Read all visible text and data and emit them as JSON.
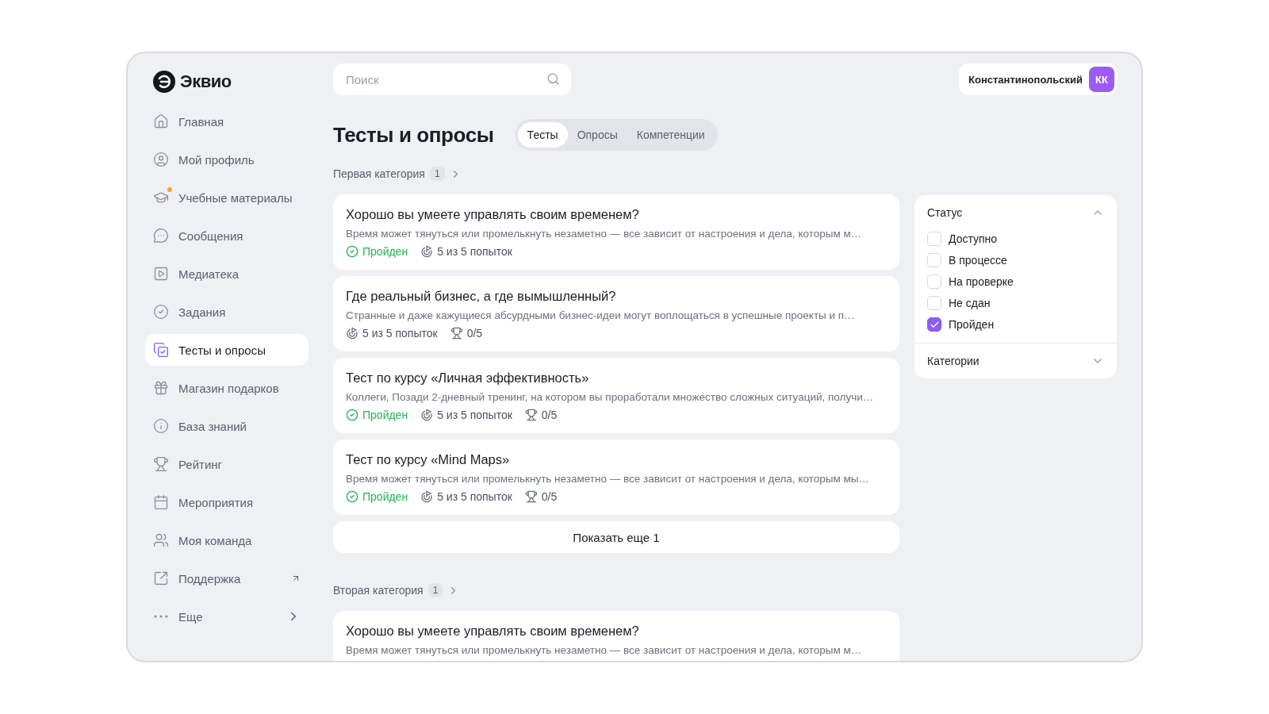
{
  "logo": {
    "name": "Эквио"
  },
  "sidebar": {
    "items": [
      {
        "label": "Главная",
        "kind": "link",
        "selected": false,
        "notification": false
      },
      {
        "label": "Мой профиль",
        "kind": "link",
        "selected": false,
        "notification": false
      },
      {
        "label": "Учебные материалы",
        "kind": "link",
        "selected": false,
        "notification": true
      },
      {
        "label": "Сообщения",
        "kind": "link",
        "selected": false,
        "notification": false
      },
      {
        "label": "Медиатека",
        "kind": "link",
        "selected": false,
        "notification": false
      },
      {
        "label": "Задания",
        "kind": "link",
        "selected": false,
        "notification": false
      },
      {
        "label": "Тесты и опросы",
        "kind": "link",
        "selected": true,
        "notification": false
      },
      {
        "label": "Магазин подарков",
        "kind": "link",
        "selected": false,
        "notification": false
      },
      {
        "label": "База знаний",
        "kind": "link",
        "selected": false,
        "notification": false
      },
      {
        "label": "Рейтинг",
        "kind": "link",
        "selected": false,
        "notification": false
      },
      {
        "label": "Мероприятия",
        "kind": "link",
        "selected": false,
        "notification": false
      },
      {
        "label": "Моя команда",
        "kind": "link",
        "selected": false,
        "notification": false
      },
      {
        "label": "Поддержка",
        "kind": "external",
        "selected": false,
        "notification": false
      },
      {
        "label": "Еще",
        "kind": "more",
        "selected": false,
        "notification": false
      }
    ]
  },
  "header": {
    "search": {
      "placeholder": "Поиск"
    },
    "user": {
      "name": "Константинопольский",
      "initials": "КК"
    }
  },
  "page_title": "Тесты и опросы",
  "tabs": [
    {
      "label": "Тесты",
      "selected": true
    },
    {
      "label": "Опросы",
      "selected": false
    },
    {
      "label": "Компетенции",
      "selected": false
    }
  ],
  "sections": [
    {
      "title": "Первая категория",
      "count": "1",
      "tests": [
        {
          "title": "Хорошо вы умеете управлять своим временем?",
          "description": "Время может тянуться или промелькнуть незаметно — все зависит от настроения и дела, которым м…",
          "status": "Пройден",
          "attempts": "5 из 5 попыток"
        },
        {
          "title": "Где реальный бизнес, а где вымышленный?",
          "description": "Странные и даже кажущиеся абсурдными бизнес-идеи могут воплощаться в успешные проекты и п…",
          "attempts": "5 из 5 попыток",
          "score": "0/5"
        },
        {
          "title": "Тест по курсу «Личная эффективность»",
          "description": "Коллеги, Позади 2-дневный тренинг, на котором вы проработали множество сложных ситуаций, получи…",
          "status": "Пройден",
          "attempts": "5 из 5 попыток",
          "score": "0/5"
        },
        {
          "title": "Тест по курсу «Mind Maps»",
          "description": "Время может тянуться или промелькнуть незаметно — все зависит от настроения и дела, которым мы…",
          "status": "Пройден",
          "attempts": "5 из 5 попыток",
          "score": "0/5"
        }
      ],
      "show_more": "Показать еще 1"
    },
    {
      "title": "Вторая категория",
      "count": "1",
      "tests": [
        {
          "title": "Хорошо вы умеете управлять своим временем?",
          "description": "Время может тянуться или промелькнуть незаметно — все зависит от настроения и дела, которым м…"
        }
      ]
    }
  ],
  "filters": [
    {
      "title": "Статус",
      "expanded": true,
      "options": [
        {
          "label": "Доступно",
          "checked": false
        },
        {
          "label": "В процессе",
          "checked": false
        },
        {
          "label": "На проверке",
          "checked": false
        },
        {
          "label": "Не сдан",
          "checked": false
        },
        {
          "label": "Пройден",
          "checked": true
        }
      ]
    },
    {
      "title": "Категории",
      "expanded": false
    }
  ]
}
